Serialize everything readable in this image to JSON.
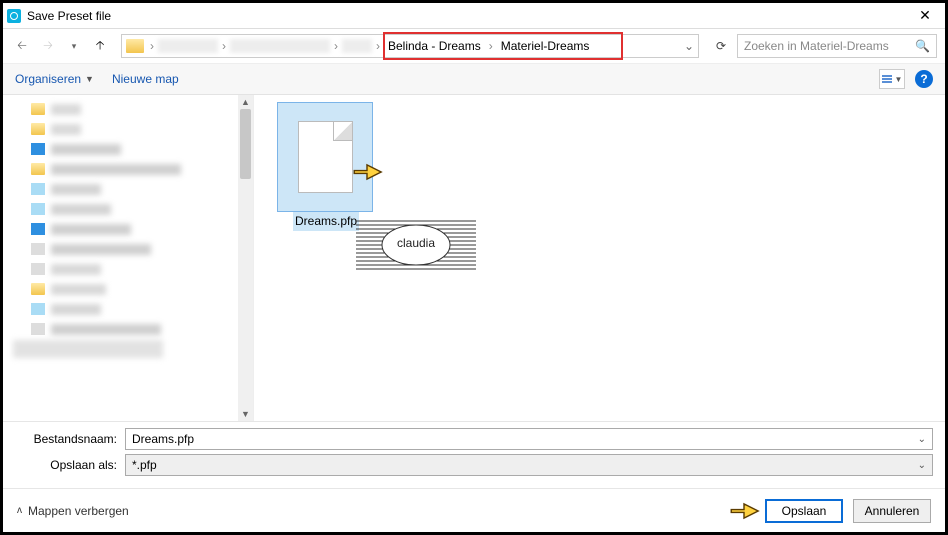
{
  "title": "Save Preset file",
  "breadcrumb": {
    "part1": "Belinda - Dreams",
    "part2": "Materiel-Dreams"
  },
  "search": {
    "placeholder": "Zoeken in Materiel-Dreams"
  },
  "toolbar": {
    "organize": "Organiseren",
    "newfolder": "Nieuwe map"
  },
  "file": {
    "name": "Dreams.pfp"
  },
  "form": {
    "filename_label": "Bestandsnaam:",
    "filename_value": "Dreams.pfp",
    "saveas_label": "Opslaan als:",
    "saveas_value": "*.pfp"
  },
  "footer": {
    "hide": "Mappen verbergen",
    "save": "Opslaan",
    "cancel": "Annuleren"
  }
}
